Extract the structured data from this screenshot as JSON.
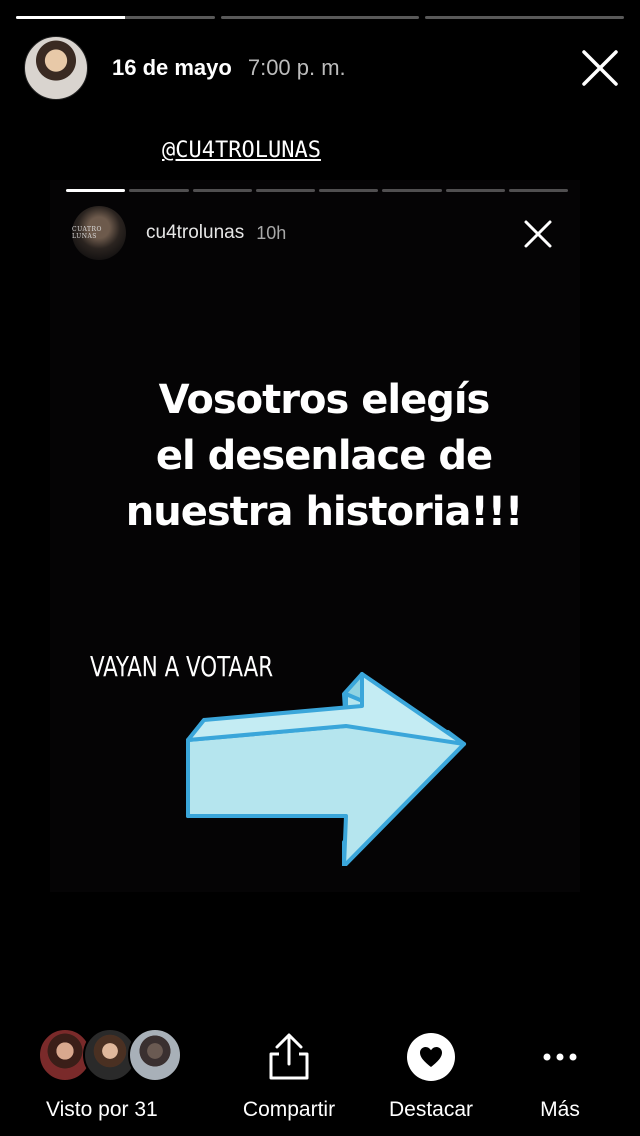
{
  "story": {
    "progress_segments": [
      0.55,
      0,
      0
    ],
    "date": "16 de mayo",
    "time": "7:00 p. m.",
    "mention": "@CU4TROLUNAS"
  },
  "shared_story": {
    "progress_segments": [
      1,
      0,
      0,
      0,
      0,
      0,
      0,
      0
    ],
    "username": "cu4trolunas",
    "age": "10h",
    "avatar_text": "CUATRO LUNAS",
    "headline_lines": [
      "Vosotros elegís",
      "el desenlace de",
      "nuestra historia!!!"
    ],
    "caption": "VAYAN A VOTAAR"
  },
  "bottom_bar": {
    "viewers_label": "Visto por 31",
    "share_label": "Compartir",
    "highlight_label": "Destacar",
    "more_label": "Más"
  },
  "colors": {
    "arrow_fill": "#b5e5ee",
    "arrow_stroke": "#3aa6da",
    "background": "#000000"
  }
}
